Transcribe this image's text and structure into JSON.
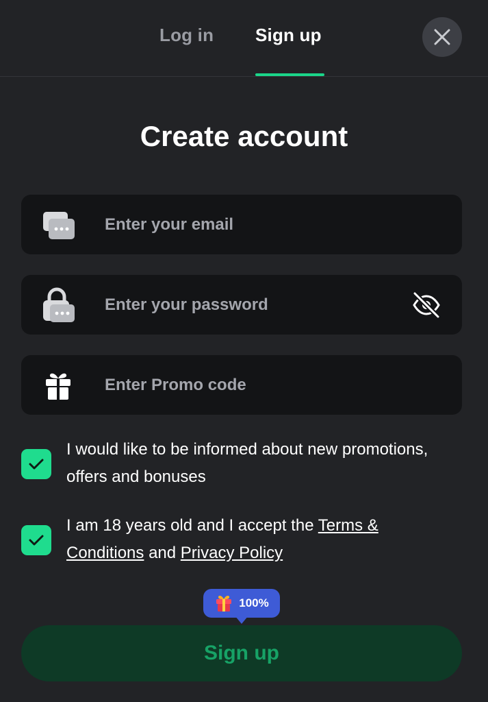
{
  "header": {
    "tabs": [
      {
        "label": "Log in",
        "active": false
      },
      {
        "label": "Sign up",
        "active": true
      }
    ],
    "close_icon": "close-icon"
  },
  "main": {
    "title": "Create account",
    "fields": {
      "email": {
        "placeholder": "Enter your email",
        "value": "",
        "icon": "email-icon"
      },
      "password": {
        "placeholder": "Enter your password",
        "value": "",
        "icon": "lock-icon",
        "toggle_icon": "eye-off-icon"
      },
      "promo": {
        "placeholder": "Enter Promo code",
        "value": "",
        "icon": "gift-icon"
      }
    },
    "checkboxes": {
      "promotions": {
        "checked": true,
        "label": "I would like to be informed about new promotions, offers and bonuses"
      },
      "terms": {
        "checked": true,
        "text_before": "I am 18 years old and I accept the ",
        "terms_link": "Terms & Conditions",
        "text_middle": " and ",
        "privacy_link": "Privacy Policy"
      }
    },
    "bonus_badge": {
      "text": "100%",
      "icon": "gift-box-icon"
    },
    "submit_label": "Sign up"
  },
  "colors": {
    "background": "#222326",
    "field_background": "#131416",
    "accent": "#1bd68a",
    "badge": "#3e5bd6",
    "button_background": "#0e3a26",
    "button_text": "#17a266"
  }
}
